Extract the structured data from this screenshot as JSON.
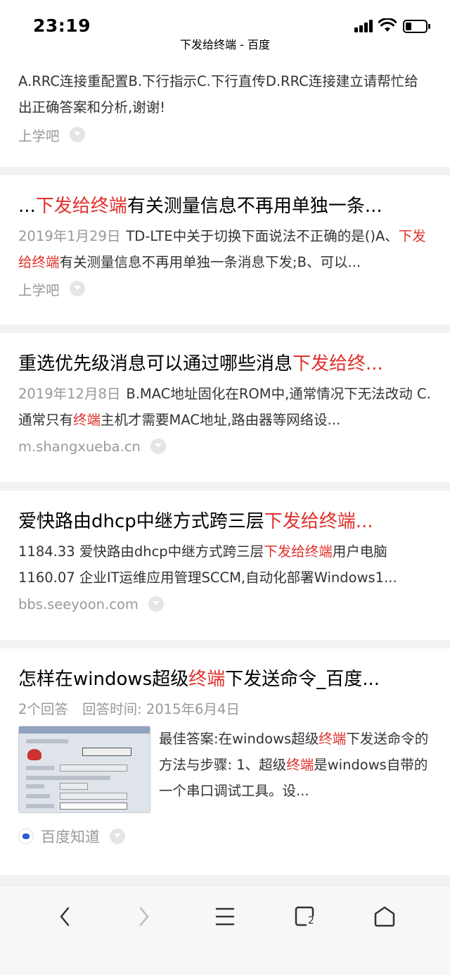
{
  "status_bar": {
    "time": "23:19",
    "title": "下发给终端 - 百度"
  },
  "results": [
    {
      "desc": "A.RRC连接重配置B.下行指示C.下行直传D.RRC连接建立请帮忙给出正确答案和分析,谢谢!",
      "source": "上学吧"
    },
    {
      "title_prefix": "...",
      "title_hl": "下发给终端",
      "title_suffix": "有关测量信息不再用单独一条...",
      "date": "2019年1月29日",
      "desc_pre": "TD-LTE中关于切换下面说法不正确的是()A、",
      "desc_hl": "下发给终端",
      "desc_post": "有关测量信息不再用单独一条消息下发;B、可以...",
      "source": "上学吧"
    },
    {
      "title_prefix": "重选优先级消息可以通过哪些消息",
      "title_hl": "下发给终...",
      "date": "2019年12月8日",
      "desc_pre": "B.MAC地址固化在ROM中,通常情况下无法改动 C.通常只有",
      "desc_hl": "终端",
      "desc_post": "主机才需要MAC地址,路由器等网络设...",
      "source": "m.shangxueba.cn"
    },
    {
      "title_prefix": "爱快路由dhcp中继方式跨三层",
      "title_hl": "下发给终端...",
      "desc_line1_pre": "1184.33 爱快路由dhcp中继方式跨三层",
      "desc_line1_hl": "下发给终端",
      "desc_line1_post": "用户电脑",
      "desc_line2": "1160.07 企业IT运维应用管理SCCM,自动化部署Windows1...",
      "source": "bbs.seeyoon.com"
    },
    {
      "title_prefix": "怎样在windows超级",
      "title_hl": "终端",
      "title_suffix": "下发送命令_百度...",
      "answer_count": "2个回答",
      "answer_time_label": "回答时间:",
      "answer_time": "2015年6月4日",
      "best_label": "最佳答案:",
      "best_pre": "在windows超级",
      "best_hl1": "终端",
      "best_mid": "下发送命令的方法与步骤: 1、超级",
      "best_hl2": "终端",
      "best_post": "是windows自带的一个串口调试工具。设...",
      "source": "百度知道"
    }
  ],
  "colors": {
    "highlight": "#e0312b",
    "muted": "#999999"
  },
  "toolbar": {
    "icons": [
      "back-icon",
      "forward-icon",
      "menu-icon",
      "tabs-icon",
      "home-icon"
    ],
    "tab_count": "2"
  }
}
